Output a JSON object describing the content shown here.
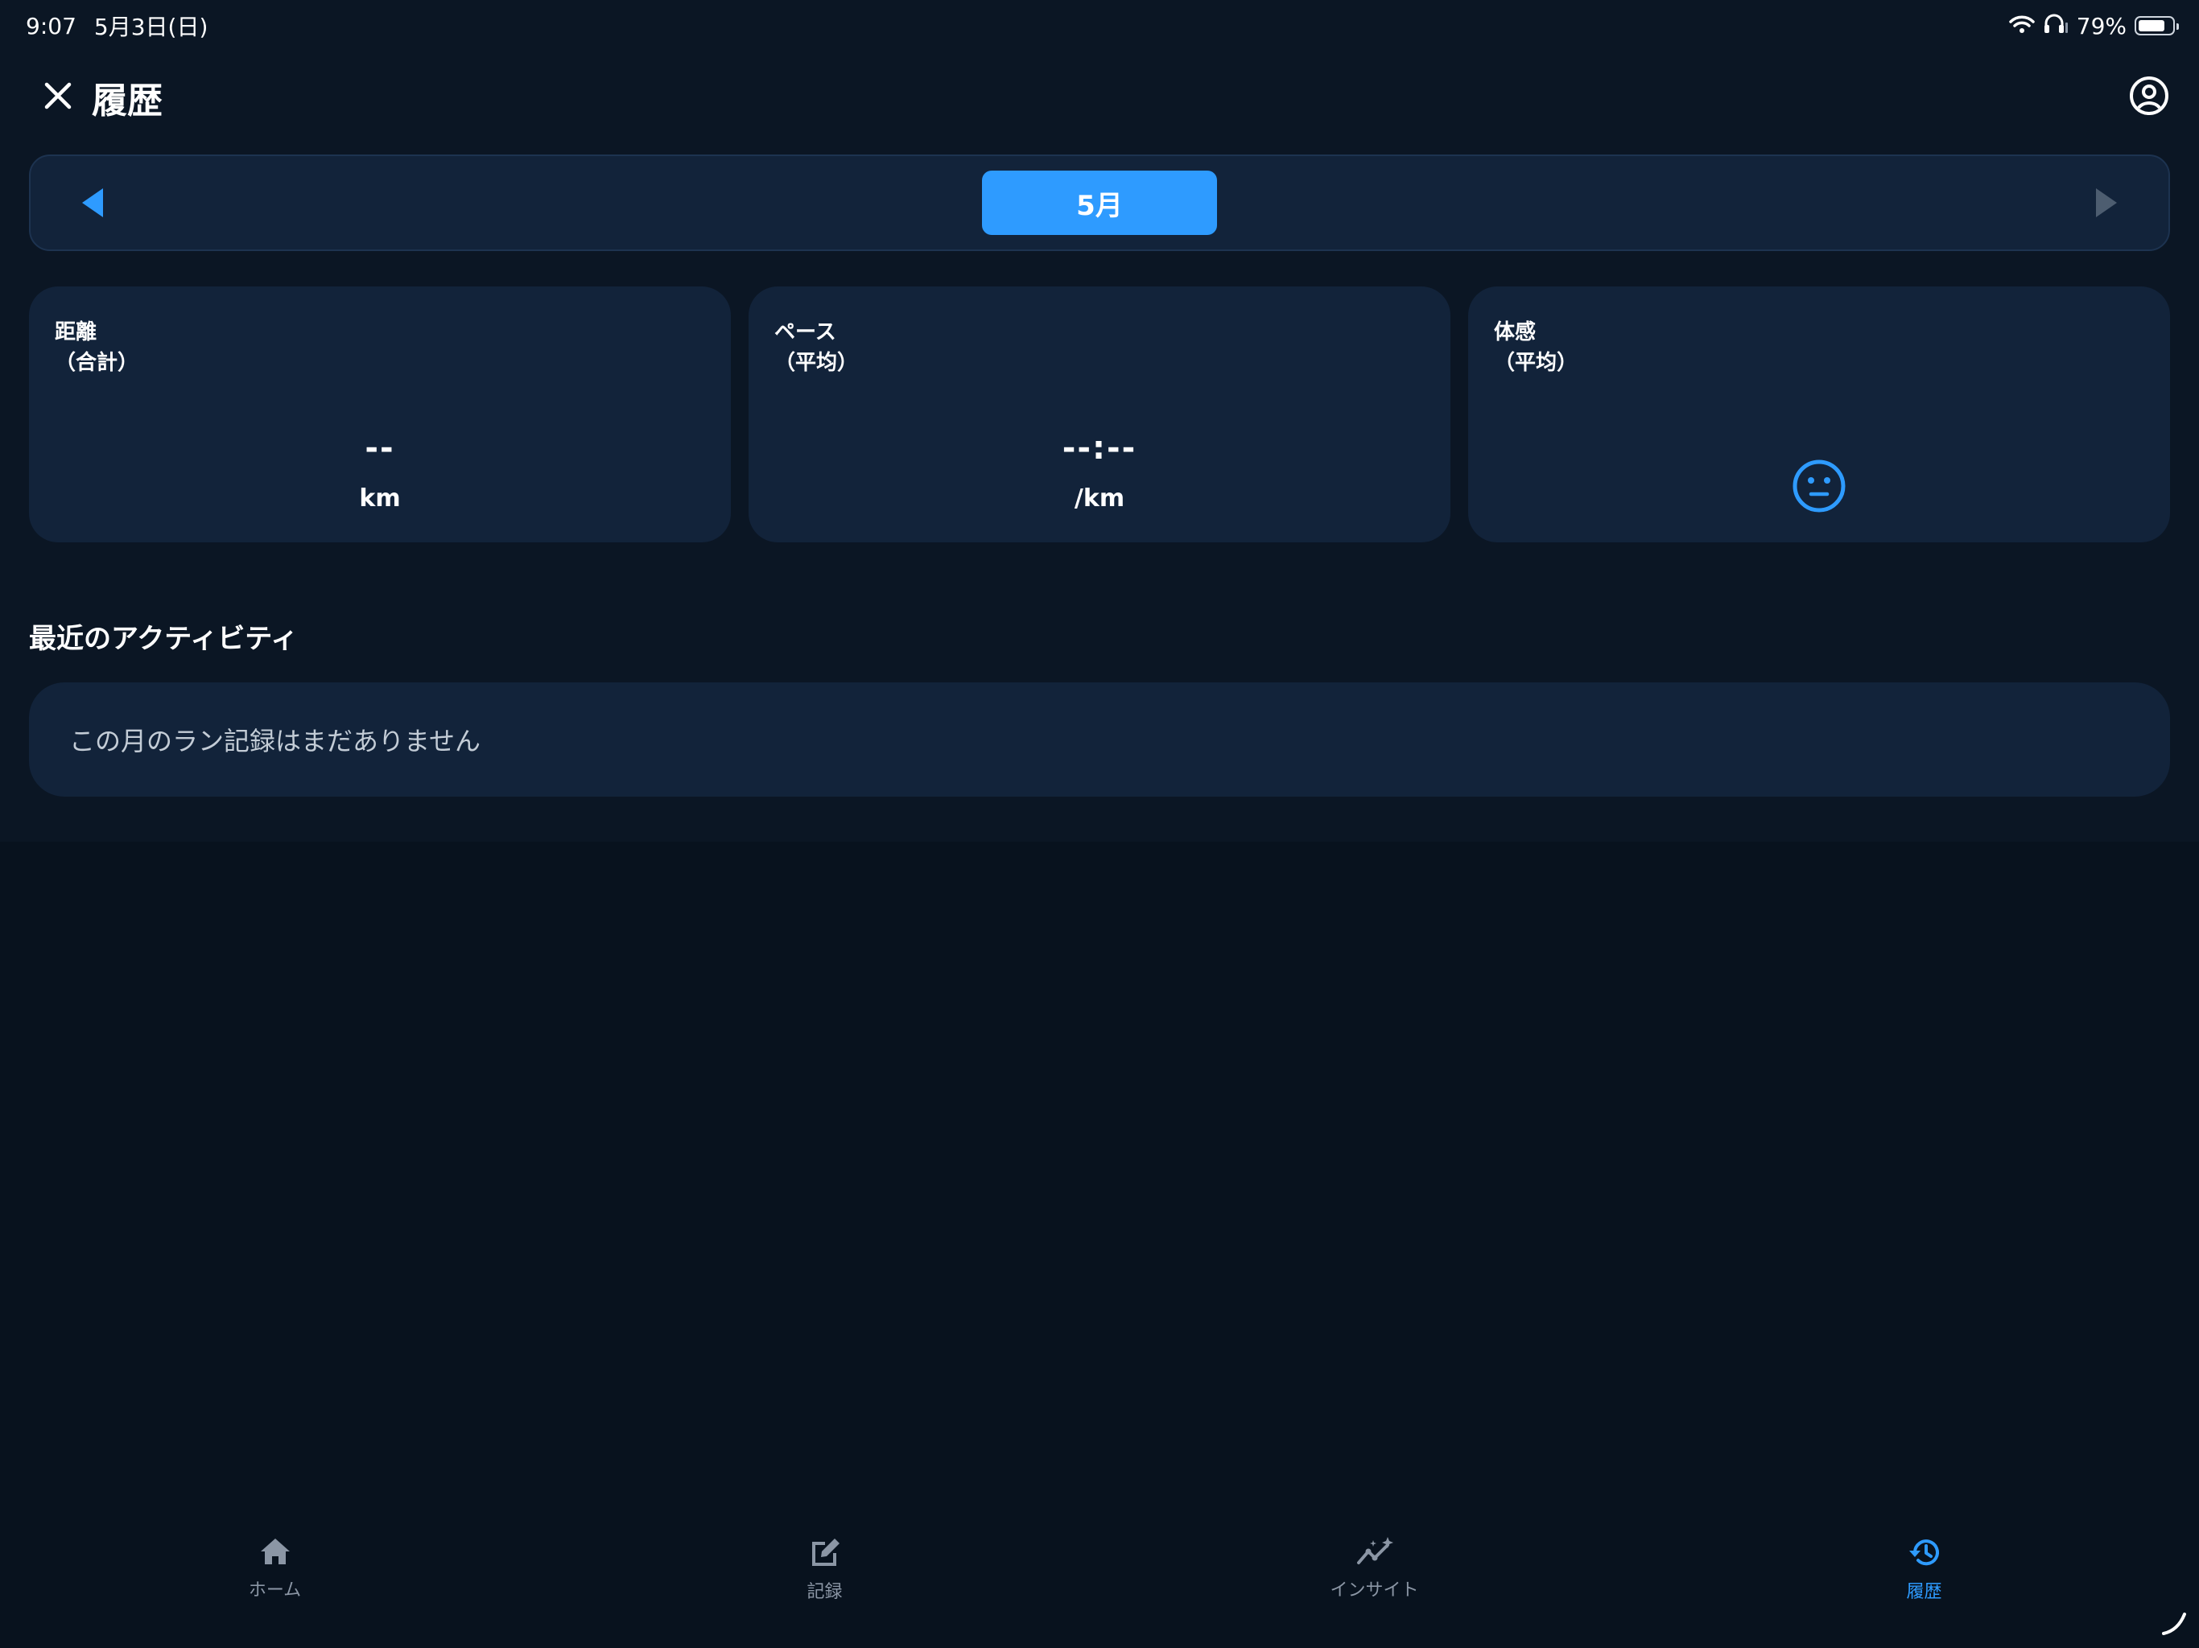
{
  "status_bar": {
    "time": "9:07",
    "date": "5月3日(日)",
    "battery": "79%",
    "battery_level": 0.79
  },
  "header": {
    "title": "履歴"
  },
  "month_selector": {
    "current": "5月"
  },
  "stats": {
    "distance": {
      "label_line1": "距離",
      "label_line2": "（合計）",
      "value": "--",
      "unit": "km"
    },
    "pace": {
      "label_line1": "ペース",
      "label_line2": "（平均）",
      "value": "--:--",
      "unit": "/km"
    },
    "feeling": {
      "label_line1": "体感",
      "label_line2": "（平均）",
      "icon": "neutral-face-icon"
    }
  },
  "recent": {
    "title": "最近のアクティビティ",
    "empty_message": "この月のラン記録はまだありません"
  },
  "tabs": [
    {
      "label": "ホーム",
      "icon": "home-icon"
    },
    {
      "label": "記録",
      "icon": "edit-icon"
    },
    {
      "label": "インサイト",
      "icon": "insights-icon"
    },
    {
      "label": "履歴",
      "icon": "history-icon",
      "active": true
    }
  ],
  "colors": {
    "accent": "#2e9bff",
    "background": "#08121e",
    "card": "#12233a",
    "inactive": "#8b96a5"
  }
}
